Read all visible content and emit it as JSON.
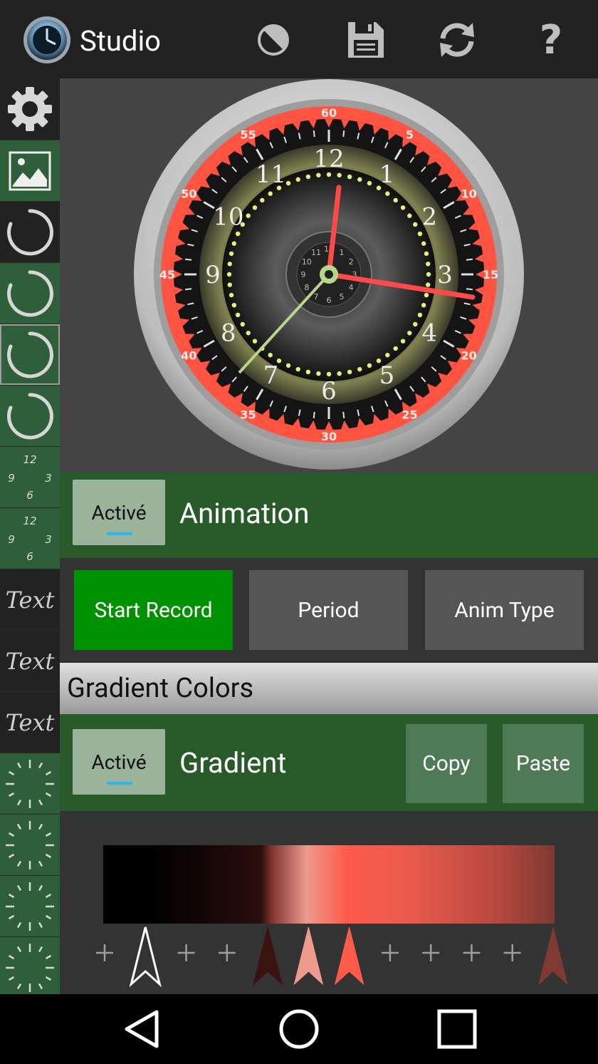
{
  "app": {
    "title": "Studio"
  },
  "toolbar": {
    "contrast_icon": "contrast-icon",
    "save_icon": "save-icon",
    "refresh_icon": "refresh-icon",
    "help_label": "?"
  },
  "sidebar": {
    "items": [
      {
        "icon": "gear-icon"
      },
      {
        "icon": "image-icon"
      },
      {
        "icon": "ring-icon"
      },
      {
        "icon": "ring-icon"
      },
      {
        "icon": "ring-icon"
      },
      {
        "icon": "ring-icon"
      },
      {
        "icon": "numbers-icon",
        "labels": [
          "12",
          "9",
          "3",
          "6"
        ]
      },
      {
        "icon": "numbers-icon",
        "labels": [
          "12",
          "9",
          "3",
          "6"
        ]
      },
      {
        "label": "Text"
      },
      {
        "label": "Text"
      },
      {
        "label": "Text"
      },
      {
        "icon": "ticks-icon"
      },
      {
        "icon": "ticks-icon"
      },
      {
        "icon": "ticks-icon"
      },
      {
        "icon": "ticks-icon"
      }
    ]
  },
  "clock": {
    "hour_numerals": [
      "12",
      "1",
      "2",
      "3",
      "4",
      "5",
      "6",
      "7",
      "8",
      "9",
      "10",
      "11"
    ],
    "minute_numerals": [
      "60",
      "5",
      "10",
      "15",
      "20",
      "25",
      "30",
      "35",
      "40",
      "45",
      "50",
      "55"
    ],
    "sub_numerals": [
      "12",
      "3",
      "6",
      "9",
      "1",
      "2",
      "4",
      "5",
      "7",
      "8",
      "10",
      "11"
    ]
  },
  "animation": {
    "toggle_label": "Activé",
    "label": "Animation",
    "start_record": "Start Record",
    "period": "Period",
    "anim_type": "Anim Type"
  },
  "gradient": {
    "section_title": "Gradient Colors",
    "toggle_label": "Activé",
    "label": "Gradient",
    "copy": "Copy",
    "paste": "Paste",
    "stops": [
      {
        "color": "#ffffff",
        "kind": "outline"
      },
      {
        "color": "#3a1210"
      },
      {
        "color": "#ee9a8d"
      },
      {
        "color": "#ff5a4a"
      },
      {
        "color": "#7d3932"
      }
    ]
  },
  "colors": {
    "accent_green": "#009100",
    "panel_green": "#285a2a",
    "focus_blue": "#29b6f6"
  },
  "nav": {
    "back": "back-icon",
    "home": "home-icon",
    "recents": "recents-icon"
  }
}
